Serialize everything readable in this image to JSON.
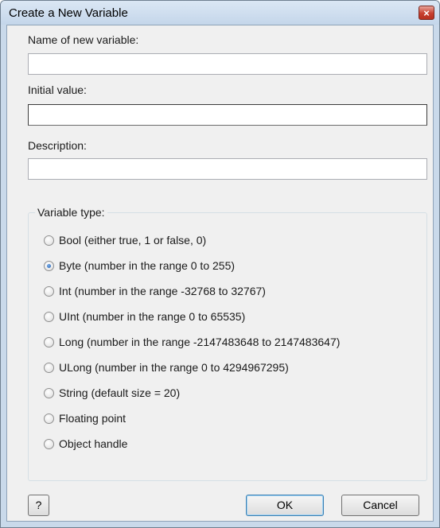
{
  "window": {
    "title": "Create a New Variable",
    "close_glyph": "×"
  },
  "fields": {
    "name": {
      "label": "Name of new variable:",
      "value": ""
    },
    "initial": {
      "label": "Initial value:",
      "value": ""
    },
    "description": {
      "label": "Description:",
      "value": ""
    }
  },
  "variable_type": {
    "legend": "Variable type:",
    "selected": "Byte (number in the range 0 to 255)",
    "options": [
      "Bool (either true, 1 or false, 0)",
      "Byte (number in the range 0 to 255)",
      "Int (number in the range -32768 to 32767)",
      "UInt (number in the range 0 to 65535)",
      "Long (number in the range -2147483648 to 2147483647)",
      "ULong (number in the range 0 to 4294967295)",
      "String (default size = 20)",
      "Floating point",
      "Object handle"
    ]
  },
  "buttons": {
    "help": "?",
    "ok": "OK",
    "cancel": "Cancel"
  },
  "colors": {
    "titlebar": "#c9d9ea",
    "client": "#f0f0f0",
    "close": "#c7402f",
    "radio_dot": "#1b5bb0"
  }
}
